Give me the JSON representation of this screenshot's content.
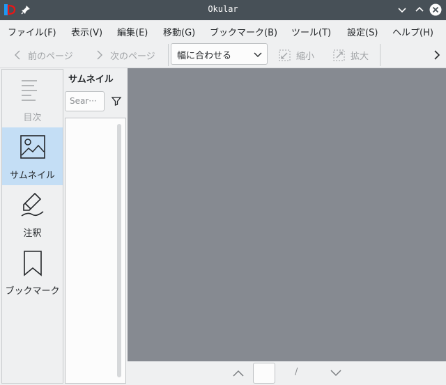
{
  "window": {
    "title": "Okular"
  },
  "menubar": {
    "items": [
      "ファイル(F)",
      "表示(V)",
      "編集(E)",
      "移動(G)",
      "ブックマーク(B)",
      "ツール(T)",
      "設定(S)",
      "ヘルプ(H)"
    ]
  },
  "toolbar": {
    "prev_page": "前のページ",
    "next_page": "次のページ",
    "zoom_value": "幅に合わせる",
    "zoom_out": "縮小",
    "zoom_in": "拡大"
  },
  "sidebar": {
    "items": [
      {
        "label": "目次",
        "icon": "toc-icon",
        "active": false,
        "enabled": false
      },
      {
        "label": "サムネイル",
        "icon": "thumbnail-image-icon",
        "active": true,
        "enabled": true
      },
      {
        "label": "注釈",
        "icon": "annotation-pen-icon",
        "active": false,
        "enabled": true
      },
      {
        "label": "ブックマーク",
        "icon": "bookmark-icon",
        "active": false,
        "enabled": true
      }
    ]
  },
  "thumbnails": {
    "title": "サムネイル",
    "search_placeholder": "Sear···"
  },
  "bottombar": {
    "page_value": "",
    "separator": "/"
  },
  "colors": {
    "titlebar": "#475057",
    "active_nav": "#c4def5",
    "document_bg": "#868a91"
  }
}
